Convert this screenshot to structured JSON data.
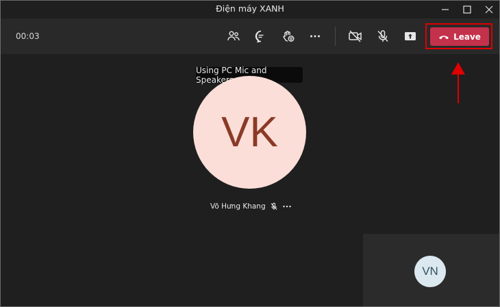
{
  "window": {
    "title": "Điện máy XANH"
  },
  "toolbar": {
    "timer": "00:03",
    "leave_label": "Leave"
  },
  "stage": {
    "tooltip": "Using PC Mic and Speakers",
    "main_participant": {
      "initials": "VK",
      "name": "Võ Hưng Khang"
    },
    "self_tile": {
      "initials": "VN"
    }
  },
  "colors": {
    "leave_button": "#c4314b",
    "avatar_vk_bg": "#fbded8",
    "avatar_vk_text": "#8a3a26",
    "avatar_vn_bg": "#dbe8ef",
    "annotation": "#e00000"
  },
  "icons": [
    "people-icon",
    "chat-icon",
    "reactions-icon",
    "more-icon",
    "camera-off-icon",
    "mic-off-icon",
    "share-screen-icon",
    "phone-hangup-icon",
    "minimize-icon",
    "maximize-icon",
    "close-icon"
  ]
}
